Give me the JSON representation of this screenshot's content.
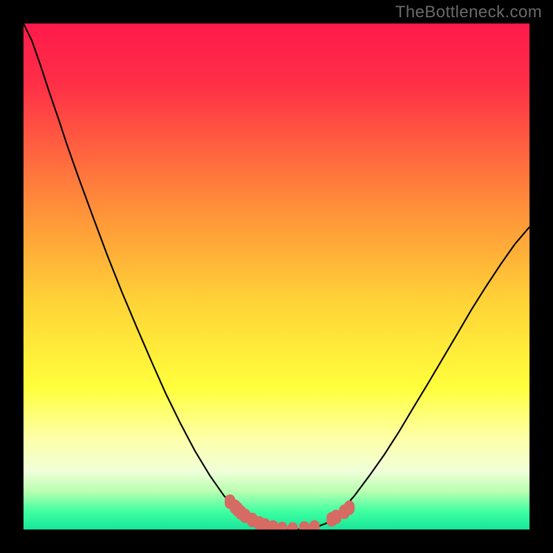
{
  "watermark": "TheBottleneck.com",
  "colors": {
    "frame": "#000000",
    "gradient_stops": [
      {
        "offset": 0.0,
        "color": "#ff1a4b"
      },
      {
        "offset": 0.12,
        "color": "#ff2f47"
      },
      {
        "offset": 0.35,
        "color": "#ff8a3a"
      },
      {
        "offset": 0.55,
        "color": "#ffd337"
      },
      {
        "offset": 0.72,
        "color": "#ffff3c"
      },
      {
        "offset": 0.82,
        "color": "#fdffa8"
      },
      {
        "offset": 0.885,
        "color": "#f0ffd8"
      },
      {
        "offset": 0.925,
        "color": "#b8ffb0"
      },
      {
        "offset": 0.965,
        "color": "#3effa0"
      },
      {
        "offset": 1.0,
        "color": "#17e59a"
      }
    ],
    "curve": "#000000",
    "marker_fill": "#d56b63",
    "marker_stroke": "#d56b63"
  },
  "chart_data": {
    "type": "line",
    "title": "",
    "xlabel": "",
    "ylabel": "",
    "xlim": [
      0,
      100
    ],
    "ylim": [
      0,
      100
    ],
    "series": [
      {
        "name": "bottleneck-curve",
        "x_norm": [
          0.0,
          0.017,
          0.034,
          0.052,
          0.069,
          0.086,
          0.109,
          0.138,
          0.166,
          0.195,
          0.224,
          0.253,
          0.281,
          0.31,
          0.339,
          0.368,
          0.396,
          0.425,
          0.447,
          0.469,
          0.488,
          0.506,
          0.523,
          0.54,
          0.558,
          0.575,
          0.598,
          0.627,
          0.655,
          0.684,
          0.713,
          0.742,
          0.77,
          0.799,
          0.828,
          0.857,
          0.885,
          0.914,
          0.943,
          0.971,
          1.0
        ],
        "y_norm": [
          1.0,
          0.965,
          0.916,
          0.861,
          0.812,
          0.76,
          0.695,
          0.616,
          0.541,
          0.468,
          0.399,
          0.332,
          0.269,
          0.21,
          0.155,
          0.107,
          0.067,
          0.035,
          0.019,
          0.009,
          0.004,
          0.0015,
          0.0,
          0.0,
          0.001,
          0.0035,
          0.012,
          0.035,
          0.068,
          0.107,
          0.148,
          0.193,
          0.24,
          0.288,
          0.337,
          0.386,
          0.434,
          0.48,
          0.524,
          0.564,
          0.598
        ]
      }
    ],
    "markers": {
      "name": "highlight-points",
      "x_norm": [
        0.408,
        0.418,
        0.423,
        0.429,
        0.438,
        0.452,
        0.466,
        0.477,
        0.493,
        0.511,
        0.532,
        0.555,
        0.575,
        0.609,
        0.618,
        0.634,
        0.644
      ],
      "y_norm": [
        0.055,
        0.045,
        0.04,
        0.034,
        0.027,
        0.019,
        0.012,
        0.008,
        0.004,
        0.001,
        0.0,
        0.002,
        0.004,
        0.02,
        0.025,
        0.035,
        0.043
      ]
    }
  }
}
